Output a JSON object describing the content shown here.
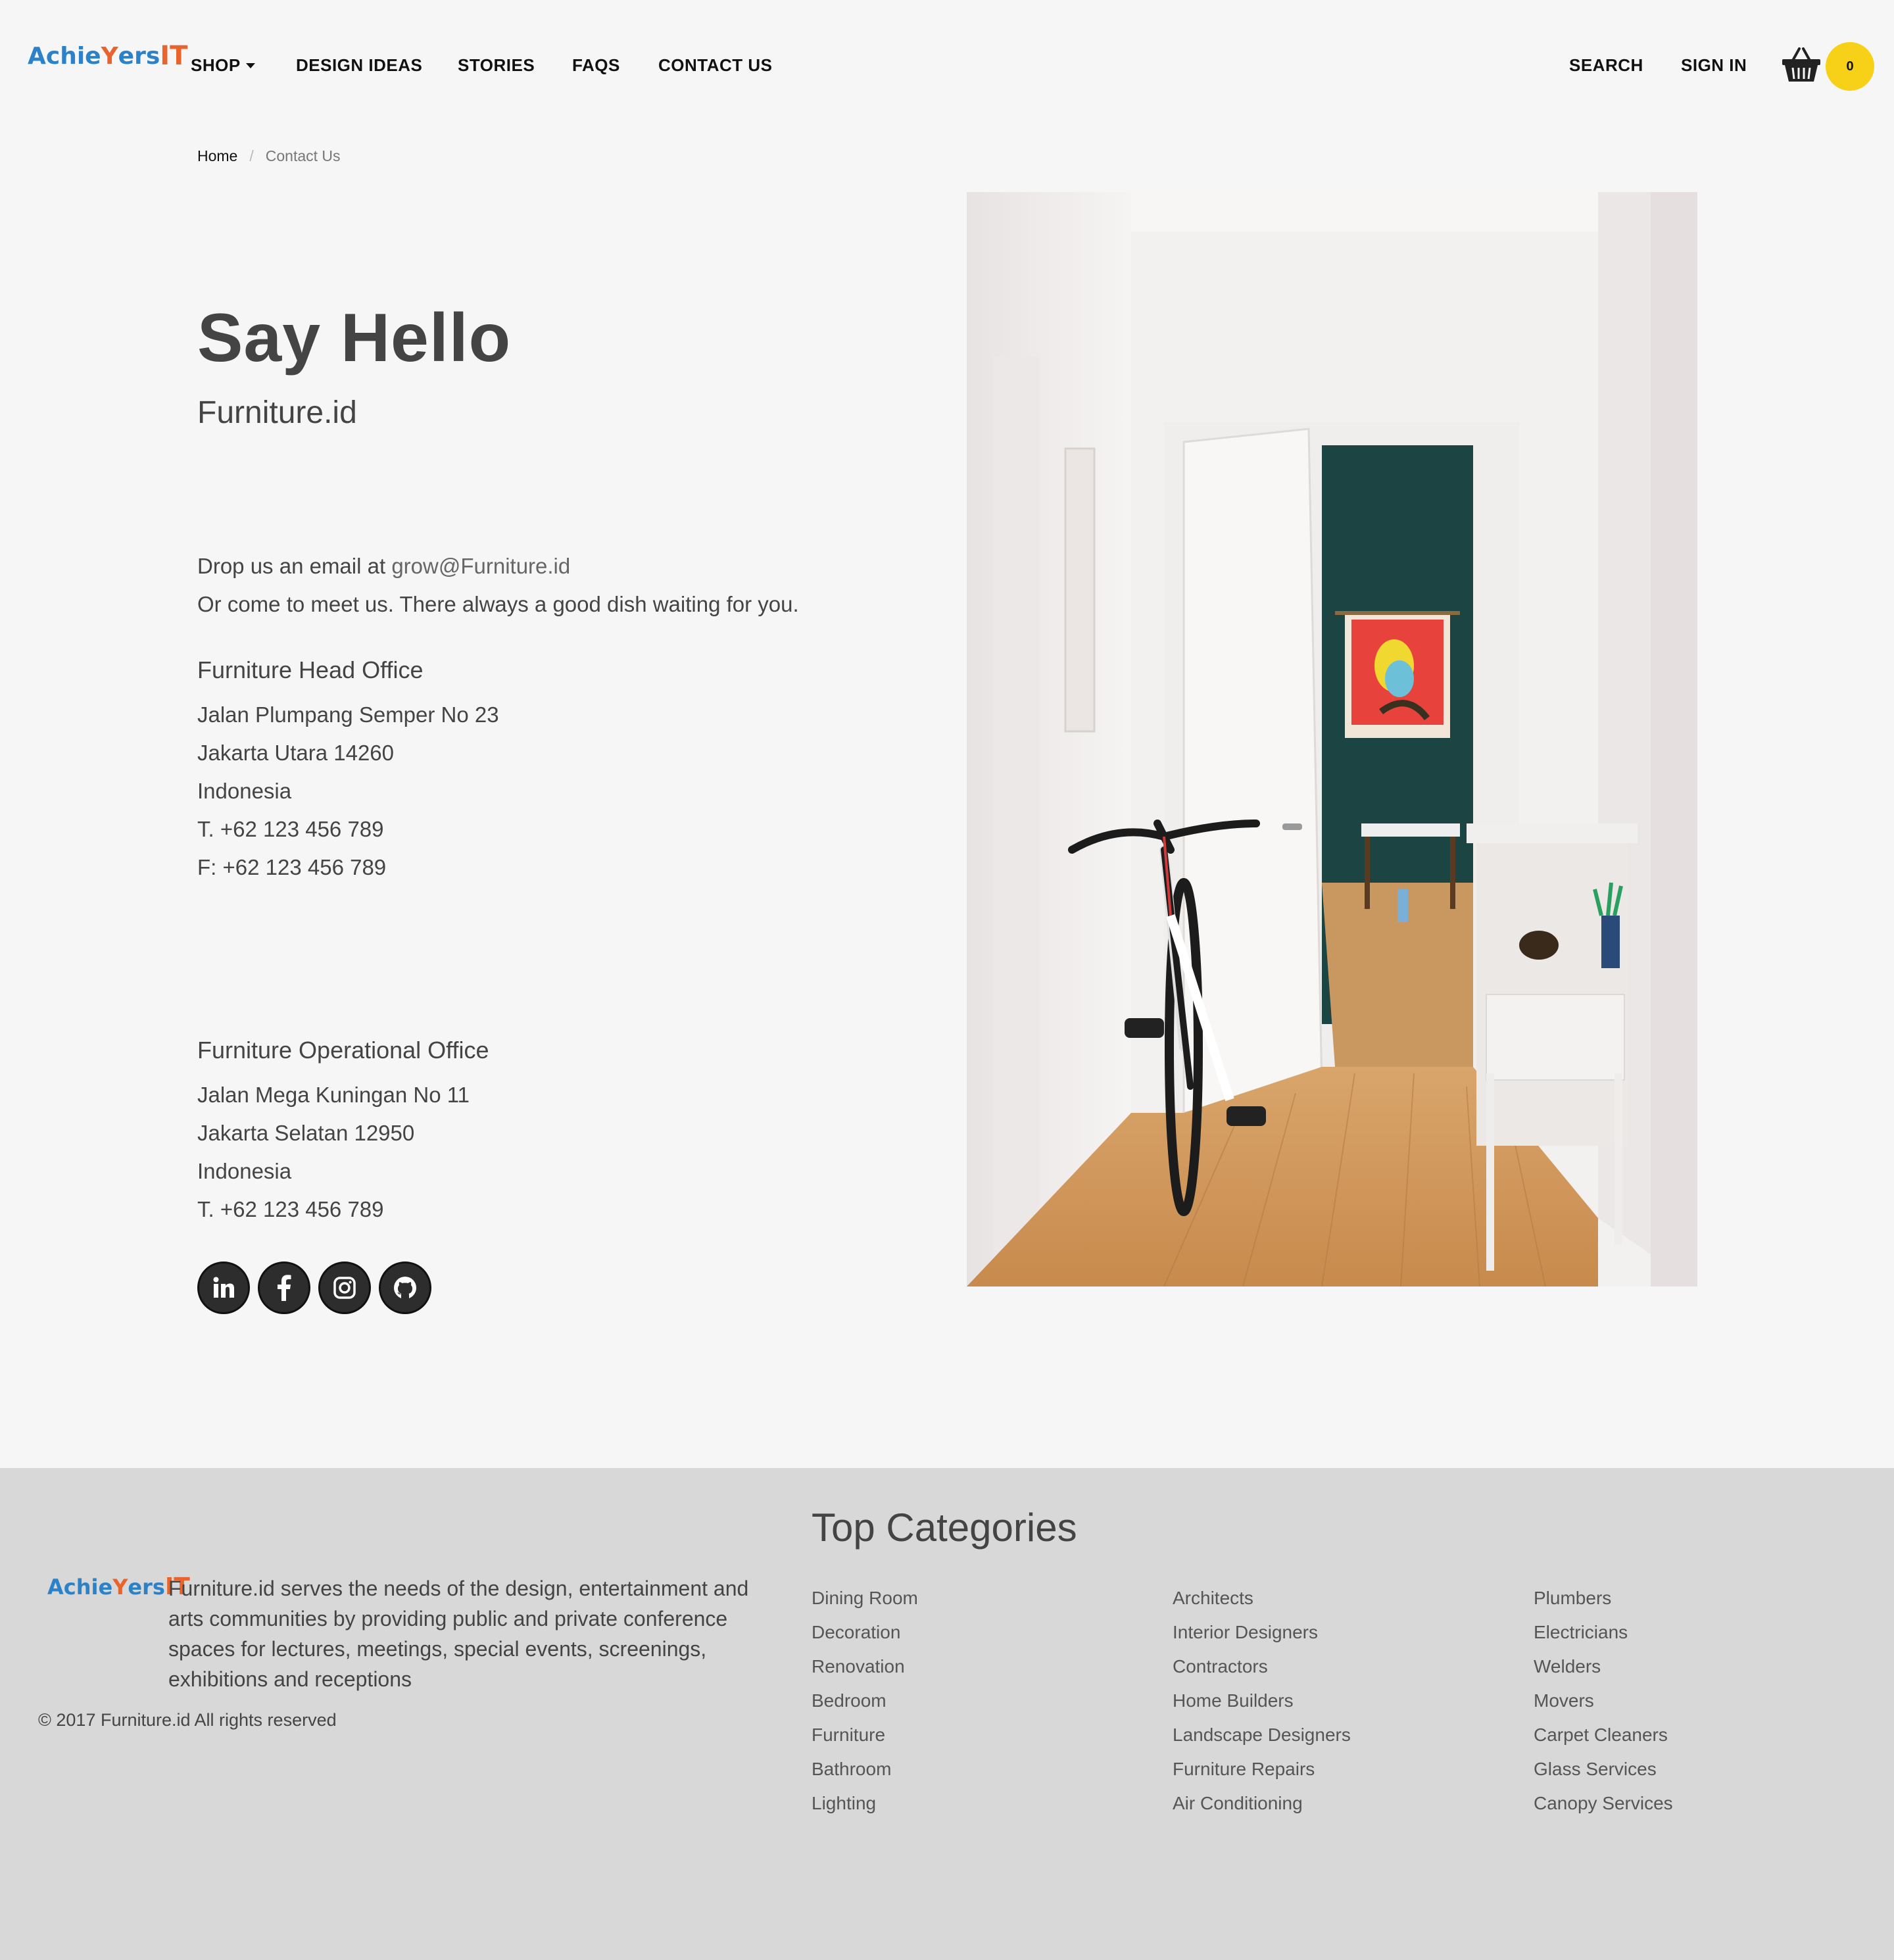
{
  "nav": {
    "logo": {
      "part1": "Achie",
      "part2": "Y",
      "part3": "ers",
      "part4": "IT"
    },
    "items": [
      "SHOP",
      "DESIGN IDEAS",
      "STORIES",
      "FAQS",
      "CONTACT US"
    ],
    "search": "SEARCH",
    "sign_in": "SIGN IN",
    "cart_count": "0"
  },
  "breadcrumb": {
    "home": "Home",
    "separator": "/",
    "current": "Contact Us"
  },
  "contact": {
    "title": "Say Hello",
    "brand": "Furniture.id",
    "email_prefix": "Drop us an email at ",
    "email": "grow@Furniture.id",
    "meet_text": "Or come to meet us. There always a good dish waiting for you.",
    "head_office": {
      "title": "Furniture Head Office",
      "lines": [
        "Jalan Plumpang Semper No 23",
        "Jakarta Utara 14260",
        "Indonesia",
        "T. +62 123 456 789",
        "F: +62 123 456 789"
      ]
    },
    "operational_office": {
      "title": "Furniture Operational Office",
      "lines": [
        "Jalan Mega Kuningan No 11",
        "Jakarta Selatan 12950",
        "Indonesia",
        "T. +62 123 456 789"
      ]
    },
    "social_icons": [
      "linkedin-icon",
      "facebook-icon",
      "instagram-icon",
      "github-icon"
    ]
  },
  "footer": {
    "logo": {
      "part1": "Achie",
      "part2": "Y",
      "part3": "ers",
      "part4": "IT"
    },
    "description": "Furniture.id serves the needs of the design, entertainment and arts communities by providing public and private conference spaces for lectures, meetings, special events, screenings, exhibitions and receptions",
    "copyright": "© 2017 Furniture.id All rights reserved",
    "top_categories_title": "Top Categories",
    "columns": [
      [
        "Dining Room",
        "Decoration",
        "Renovation",
        "Bedroom",
        "Furniture",
        "Bathroom",
        "Lighting"
      ],
      [
        "Architects",
        "Interior Designers",
        "Contractors",
        "Home Builders",
        "Landscape Designers",
        "Furniture Repairs",
        "Air Conditioning"
      ],
      [
        "Plumbers",
        "Electricians",
        "Welders",
        "Movers",
        "Carpet Cleaners",
        "Glass Services",
        "Canopy Services"
      ]
    ]
  },
  "colors": {
    "background": "#f6f6f6",
    "footer_bg": "#d8d8d8",
    "cart_badge": "#f7d117",
    "logo_blue": "#2b82c9",
    "logo_orange": "#e8642c",
    "social_bg": "#2d2d2d"
  }
}
